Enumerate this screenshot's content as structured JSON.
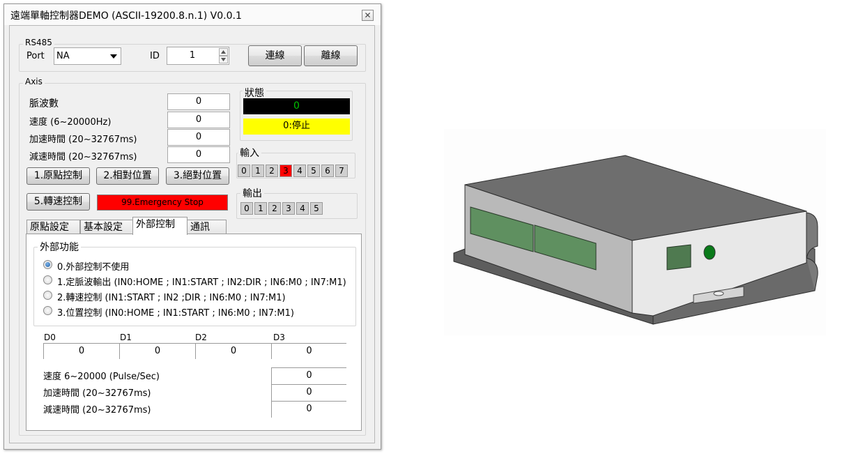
{
  "window": {
    "title": "遠端單軸控制器DEMO (ASCII-19200.8.n.1) V0.0.1",
    "close_glyph": "✕"
  },
  "rs485": {
    "legend": "RS485",
    "port_label": "Port",
    "port_value": "NA",
    "id_label": "ID",
    "id_value": "1",
    "connect_label": "連線",
    "disconnect_label": "離線"
  },
  "axis": {
    "legend": "Axis",
    "fields": [
      {
        "label": "脈波數",
        "value": "0"
      },
      {
        "label": "速度 (6~20000Hz)",
        "value": "0"
      },
      {
        "label": "加速時間 (20~32767ms)",
        "value": "0"
      },
      {
        "label": "減速時間 (20~32767ms)",
        "value": "0"
      }
    ],
    "buttons": {
      "home": "1.原點控制",
      "relative": "2.相對位置",
      "absolute": "3.絕對位置",
      "speed": "5.轉速控制",
      "estop": "99.Emergency Stop"
    },
    "status": {
      "label": "狀態",
      "value": "0",
      "text": "0:停止"
    },
    "inputs": {
      "label": "輸入",
      "items": [
        "0",
        "1",
        "2",
        "3",
        "4",
        "5",
        "6",
        "7"
      ],
      "active_index": 3
    },
    "outputs": {
      "label": "輸出",
      "items": [
        "0",
        "1",
        "2",
        "3",
        "4",
        "5"
      ]
    }
  },
  "tabs": {
    "items": [
      "原點設定",
      "基本設定",
      "外部控制",
      "通訊"
    ],
    "active_index": 2
  },
  "external": {
    "legend": "外部功能",
    "options": [
      "0.外部控制不使用",
      "1.定脈波輸出 (IN0:HOME ; IN1:START ; IN2:DIR ; IN6:M0 ; IN7:M1)",
      "2.轉速控制 (IN1:START ; IN2 ;DIR ; IN6:M0 ; IN7:M1)",
      "3.位置控制 (IN0:HOME ; IN1:START ; IN6:M0 ; IN7:M1)"
    ],
    "selected_index": 0,
    "d_headers": [
      "D0",
      "D1",
      "D2",
      "D3"
    ],
    "d_values": [
      "0",
      "0",
      "0",
      "0"
    ],
    "params": [
      {
        "label": "速度 6~20000 (Pulse/Sec)",
        "value": "0"
      },
      {
        "label": "加速時間 (20~32767ms)",
        "value": "0"
      },
      {
        "label": "減速時間 (20~32767ms)",
        "value": "0"
      }
    ]
  },
  "colors": {
    "estop": "#ff0000",
    "status_value_bg": "#000000",
    "status_value_fg": "#00c000",
    "status_text_bg": "#ffff00",
    "input_active": "#ff0000"
  },
  "device_image": {
    "icon": "controller-device-3d-model"
  }
}
